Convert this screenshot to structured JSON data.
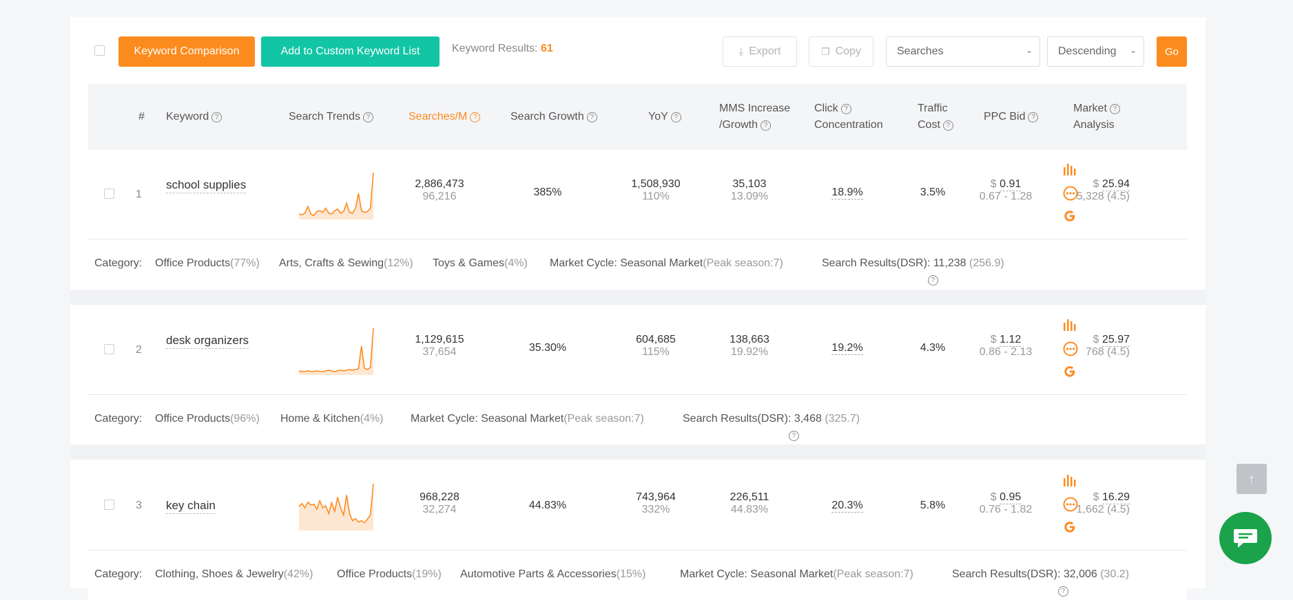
{
  "toolbar": {
    "keyword_comparison_label": "Keyword Comparison",
    "add_to_list_label": "Add to Custom Keyword List",
    "results_label": "Keyword Results:",
    "results_count": "61",
    "export_label": "Export",
    "copy_label": "Copy",
    "sort_field": "Searches",
    "sort_order": "Descending",
    "go_label": "Go"
  },
  "columns": {
    "num": "#",
    "keyword": "Keyword",
    "search_trends": "Search Trends",
    "searches_m": "Searches/M",
    "search_growth": "Search Growth",
    "yoy": "YoY",
    "mms_1": "MMS Increase",
    "mms_2": "/Growth",
    "click_1": "Click",
    "click_2": "Concentration",
    "traffic_1": "Traffic",
    "traffic_2": "Cost",
    "ppc": "PPC Bid",
    "market_1": "Market",
    "market_2": "Analysis"
  },
  "rows": [
    {
      "index": "1",
      "keyword": "school supplies",
      "searches": "2,886,473",
      "searches_sub": "96,216",
      "growth": "385%",
      "yoy": "1,508,930",
      "yoy_sub": "110%",
      "mms": "35,103",
      "mms_sub": "13.09%",
      "click": "18.9%",
      "traffic": "3.5%",
      "ppc_currency": "$",
      "ppc": "0.91",
      "ppc_range": "0.67 - 1.28",
      "market_currency": "$",
      "market": "25.94",
      "market_sub": "5,328 (4.5)",
      "category_label": "Category:",
      "categories": [
        {
          "name": "Office Products",
          "pct": "(77%)"
        },
        {
          "name": "Arts, Crafts & Sewing",
          "pct": "(12%)"
        },
        {
          "name": "Toys & Games",
          "pct": "(4%)"
        }
      ],
      "cycle_label": "Market Cycle: Seasonal Market",
      "peak": "(Peak season:7)",
      "dsr_label": "Search Results(DSR)",
      "dsr_value": ": 11,238",
      "dsr_score": "(256.9)",
      "trend": [
        5,
        4,
        6,
        14,
        5,
        3,
        8,
        9,
        7,
        12,
        6,
        5,
        9,
        11,
        6,
        8,
        18,
        7,
        6,
        12,
        30,
        9,
        7,
        8,
        12,
        55
      ]
    },
    {
      "index": "2",
      "keyword": "desk organizers",
      "searches": "1,129,615",
      "searches_sub": "37,654",
      "growth": "35.30%",
      "yoy": "604,685",
      "yoy_sub": "115%",
      "mms": "138,663",
      "mms_sub": "19.92%",
      "click": "19.2%",
      "traffic": "4.3%",
      "ppc_currency": "$",
      "ppc": "1.12",
      "ppc_range": "0.86 - 2.13",
      "market_currency": "$",
      "market": "25.97",
      "market_sub": "768 (4.5)",
      "category_label": "Category:",
      "categories": [
        {
          "name": "Office Products",
          "pct": "(96%)"
        },
        {
          "name": "Home & Kitchen",
          "pct": "(4%)"
        }
      ],
      "cycle_label": "Market Cycle: Seasonal Market",
      "peak": "(Peak season:7)",
      "dsr_label": "Search Results(DSR)",
      "dsr_value": ": 3,468",
      "dsr_score": "(325.7)",
      "trend": [
        4,
        3,
        3,
        4,
        3,
        3,
        4,
        3,
        3,
        4,
        5,
        4,
        3,
        4,
        5,
        4,
        5,
        6,
        5,
        6,
        7,
        40,
        8,
        6,
        9,
        66
      ]
    },
    {
      "index": "3",
      "keyword": "key chain",
      "searches": "968,228",
      "searches_sub": "32,274",
      "growth": "44.83%",
      "yoy": "743,964",
      "yoy_sub": "332%",
      "mms": "226,511",
      "mms_sub": "44.83%",
      "click": "20.3%",
      "traffic": "5.8%",
      "ppc_currency": "$",
      "ppc": "0.95",
      "ppc_range": "0.76 - 1.82",
      "market_currency": "$",
      "market": "16.29",
      "market_sub": "1,662 (4.5)",
      "category_label": "Category:",
      "categories": [
        {
          "name": "Clothing, Shoes & Jewelry",
          "pct": "(42%)"
        },
        {
          "name": "Office Products",
          "pct": "(19%)"
        },
        {
          "name": "Automotive Parts & Accessories",
          "pct": "(15%)"
        }
      ],
      "cycle_label": "Market Cycle: Seasonal Market",
      "peak": "(Peak season:7)",
      "dsr_label": "Search Results(DSR)",
      "dsr_value": ": 32,006",
      "dsr_score": "(30.2)",
      "trend": [
        32,
        36,
        30,
        38,
        34,
        35,
        28,
        40,
        30,
        33,
        22,
        37,
        25,
        45,
        30,
        20,
        48,
        22,
        12,
        15,
        10,
        12,
        9,
        14,
        20,
        64
      ]
    }
  ],
  "colors": {
    "orange": "#fc8b1e",
    "green": "#12c5a5",
    "chat": "#1aa34a"
  }
}
